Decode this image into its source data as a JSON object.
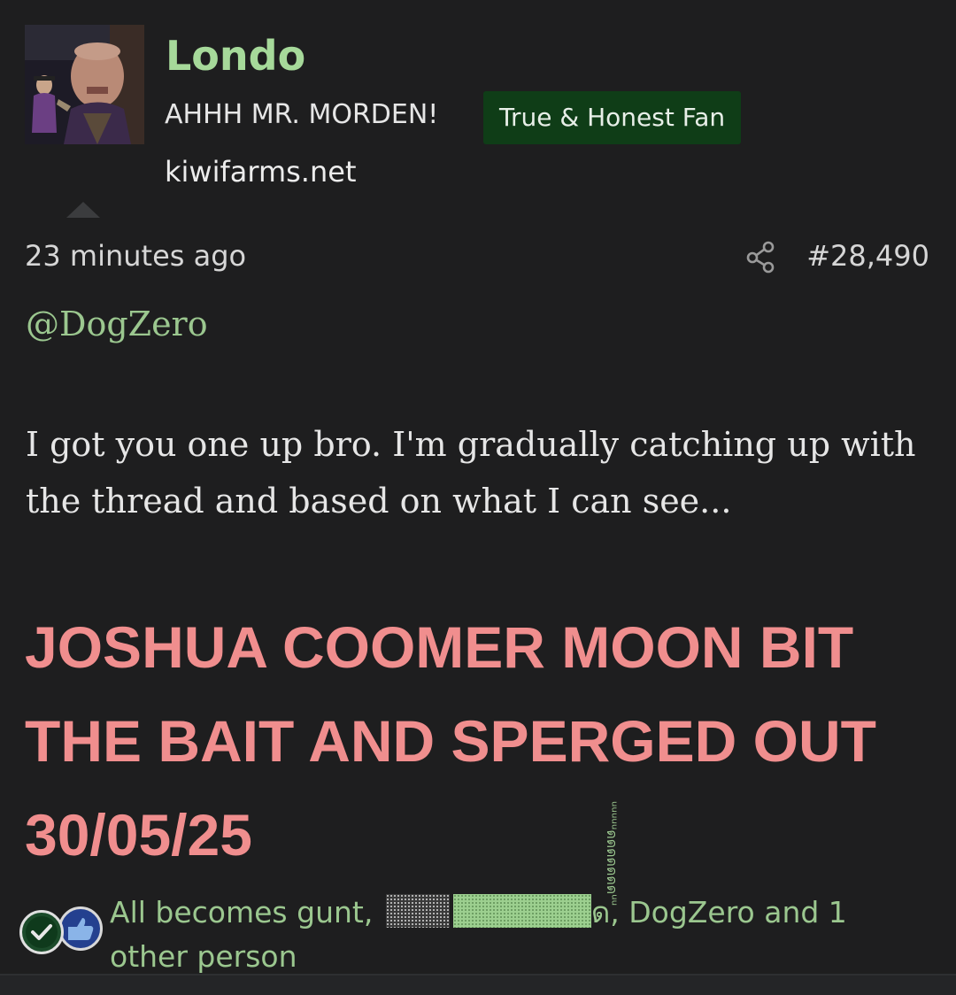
{
  "post": {
    "author": {
      "name": "Londo",
      "user_title": "AHHH MR. MORDEN!",
      "banner": "True & Honest Fan",
      "site": "kiwifarms.net"
    },
    "timestamp": "23 minutes ago",
    "post_number": "#28,490",
    "mention": "@DogZero",
    "body": "I got you one up bro. I'm gradually catching up with the thread and based on what I can see...",
    "shout_lines": [
      "JOSHUA COOMER MOON BIT",
      "THE BAIT AND SPERGED OUT",
      "30/05/25"
    ],
    "reactions": {
      "prefix": "All becomes gunt,",
      "tail_char": "ด",
      "suffix": ", DogZero and 1 other person",
      "zalgo": "ᵘᵘᵘᵘᵘดดดดดดดᵘᵘ"
    }
  },
  "colors": {
    "background": "#1e1e1f",
    "username": "#a6d99a",
    "link": "#9bc78f",
    "shout": "#f08e8e",
    "banner_bg": "#0f3d17"
  },
  "icons": {
    "share": "share-icon",
    "reaction_like": "thumbs-up-icon",
    "reaction_agree": "checkmark-icon"
  }
}
